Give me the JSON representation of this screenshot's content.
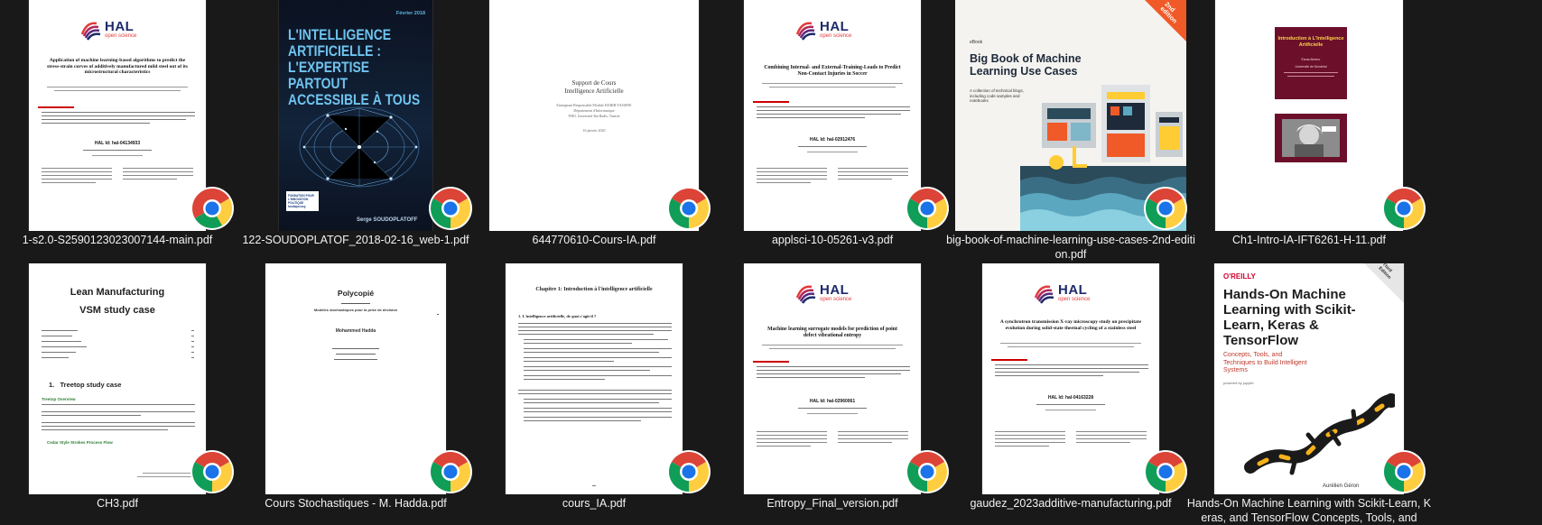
{
  "window": {
    "background": "#191919"
  },
  "files": [
    {
      "name": "1-s2.0-S2590123023007144-main.pdf",
      "type": "hal-paper",
      "texts": {
        "logo": "HAL",
        "logo_sub": "open science",
        "title": "Application of machine learning-based algorithms to predict the stress-strain curves of additively manufactured mild steel out of its microstructural characteristics",
        "hal_id": "HAL Id: hal-04134933"
      }
    },
    {
      "name": "122-SOUDOPLATOF_2018-02-16_web-1.pdf",
      "type": "brain-cover",
      "texts": {
        "date": "Février 2018",
        "title": "L'INTELLIGENCE ARTIFICIELLE : L'EXPERTISE PARTOUT ACCESSIBLE À TOUS",
        "author": "Serge SOUDOPLATOFF",
        "publisher": "FONDATION POUR L'INNOVATION POLITIQUE fondapol.org"
      }
    },
    {
      "name": "644770610-Cours-IA.pdf",
      "type": "course",
      "texts": {
        "line1": "Support de Cours",
        "line2": "Intelligence Artificielle",
        "meta1": "Enseignant Responsable Module HABIB YASSINE",
        "meta2": "Département d'Informatique",
        "meta3": "FSEI, Université Ibn Badis, Tunisie",
        "date": "16 janvier 2020"
      }
    },
    {
      "name": "applsci-10-05261-v3.pdf",
      "type": "hal-paper",
      "texts": {
        "logo": "HAL",
        "logo_sub": "open science",
        "title": "Combining Internal- and External-Training-Loads to Predict Non-Contact Injuries in Soccer",
        "hal_id": "HAL Id: hal-02912476"
      }
    },
    {
      "name": "big-book-of-machine-learning-use-cases-2nd-edition.pdf",
      "type": "ebook-cover",
      "texts": {
        "tag": "eBook",
        "title": "Big Book of Machine Learning Use Cases",
        "subtitle": "A collection of technical blogs, including code samples and notebooks",
        "badge": "2nd edition"
      }
    },
    {
      "name": "Ch1-Intro-IA-IFT6261-H-11.pdf",
      "type": "slides",
      "texts": {
        "title": "Introduction à L'Intelligence Artificielle",
        "author": "Esma Aïmeur",
        "dept": "Université de Montréal"
      }
    },
    {
      "name": "CH3.pdf",
      "type": "report",
      "texts": {
        "title1": "Lean Manufacturing",
        "title2": "VSM study case",
        "section": "1.   Treetop study case",
        "sub1": "Treetop Overview",
        "sub2": "Cedar Style Strokes Process Flow"
      }
    },
    {
      "name": "Cours Stochastiques - M. Hadda.pdf",
      "type": "polycopie",
      "texts": {
        "title": "Polycopié",
        "sub": "Modèles stochastiques pour la prise de décision",
        "author": "Mohammed Hadda"
      }
    },
    {
      "name": "cours_IA.pdf",
      "type": "chapter",
      "texts": {
        "title": "Chapitre 1: Introduction à l'intelligence artificielle",
        "h1": "1. L'intelligence artificielle, de quoi s'agit-il ?"
      }
    },
    {
      "name": "Entropy_Final_version.pdf",
      "type": "hal-paper",
      "texts": {
        "logo": "HAL",
        "logo_sub": "open science",
        "title": "Machine learning surrogate models for prediction of point defect vibrational entropy",
        "hal_id": "HAL Id: hal-02960061"
      }
    },
    {
      "name": "gaudez_2023additive-manufacturing.pdf",
      "type": "hal-paper",
      "texts": {
        "logo": "HAL",
        "logo_sub": "open science",
        "title": "A synchrotron transmission X-ray microscopy study on precipitate evolution during solid-state thermal cycling of a stainless steel",
        "hal_id": "HAL Id: hal-04163228"
      }
    },
    {
      "name": "Hands-On Machine Learning with Scikit-Learn, Keras, and TensorFlow Concepts, Tools, and",
      "type": "oreilly-cover",
      "texts": {
        "publisher": "O'REILLY",
        "edition": "Third Edition",
        "title": "Hands-On Machine Learning with Scikit-Learn, Keras & TensorFlow",
        "subtitle": "Concepts, Tools, and Techniques to Build Intelligent Systems",
        "author": "Aurélien Géron",
        "powered": "powered by jupyter"
      }
    }
  ],
  "icons": {
    "badge": "chrome-icon"
  },
  "colors": {
    "hal_navy": "#1d2a6b",
    "hal_red": "#e23a3a",
    "slide_maroon": "#6b0f2b",
    "ebook_orange": "#f05a28",
    "oreilly_red": "#d3002d"
  }
}
